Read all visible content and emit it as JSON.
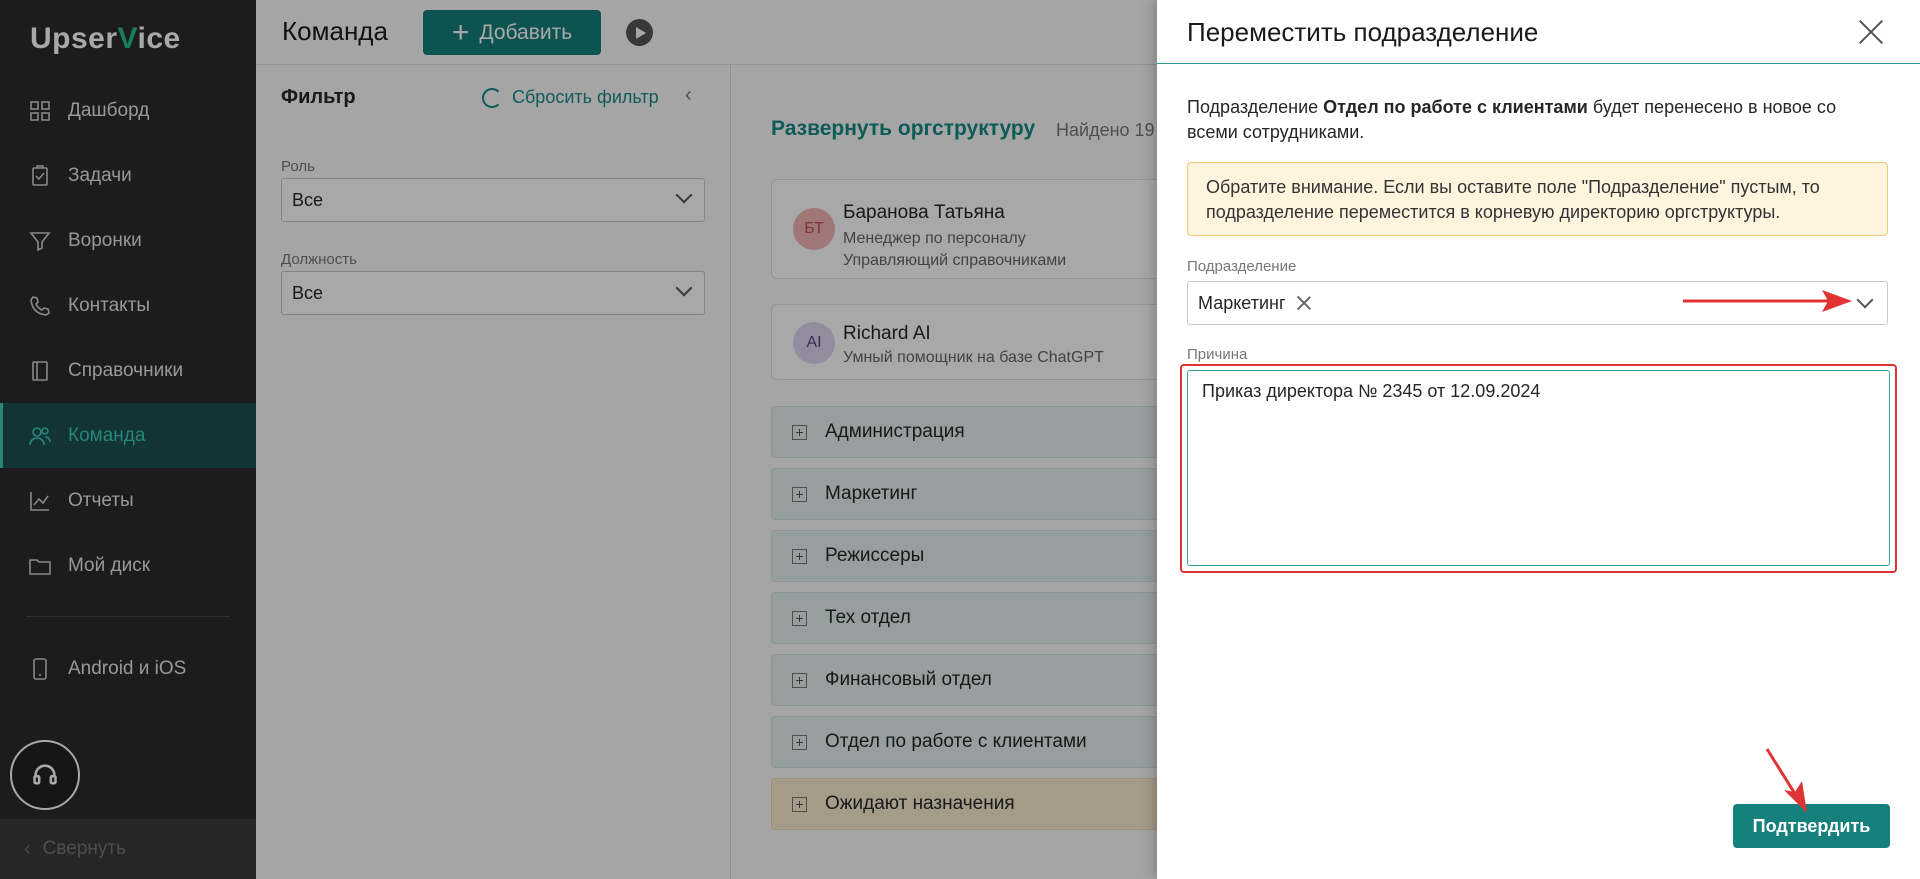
{
  "app": {
    "logo_prefix": "Upser",
    "logo_v": "V",
    "logo_suffix": "ice"
  },
  "sidebar": {
    "items": [
      {
        "label": "Дашборд",
        "icon": "dashboard-icon"
      },
      {
        "label": "Задачи",
        "icon": "tasks-icon"
      },
      {
        "label": "Воронки",
        "icon": "funnel-icon"
      },
      {
        "label": "Контакты",
        "icon": "contacts-icon"
      },
      {
        "label": "Справочники",
        "icon": "book-icon"
      },
      {
        "label": "Команда",
        "icon": "team-icon",
        "active": true
      },
      {
        "label": "Отчеты",
        "icon": "chart-icon"
      },
      {
        "label": "Мой диск",
        "icon": "folder-icon"
      }
    ],
    "mobile_label": "Android и iOS",
    "collapse_label": "Свернуть"
  },
  "header": {
    "title": "Команда",
    "add_label": "Добавить"
  },
  "filter": {
    "title": "Фильтр",
    "reset_label": "Сбросить фильтр",
    "role_label": "Роль",
    "role_value": "Все",
    "position_label": "Должность",
    "position_value": "Все"
  },
  "main": {
    "expand_label": "Развернуть оргструктуру",
    "found_label": "Найдено 19",
    "people": [
      {
        "initials": "БТ",
        "name": "Баранова Татьяна",
        "line1": "Менеджер по персоналу",
        "line2": "Управляющий справочниками"
      },
      {
        "initials": "AI",
        "name": "Richard AI",
        "line1": "Умный помощник на базе ChatGPT"
      }
    ],
    "departments": [
      "Администрация",
      "Маркетинг",
      "Режиссеры",
      "Тех отдел",
      "Финансовый отдел",
      "Отдел по работе с клиентами",
      "Ожидают назначения"
    ]
  },
  "drawer": {
    "title": "Переместить подразделение",
    "desc_prefix": "Подразделение ",
    "desc_dept": "Отдел по работе с клиентами",
    "desc_suffix": " будет перенесено в новое со всеми сотрудниками.",
    "warning": "Обратите внимание. Если вы оставите поле \"Подразделение\" пустым, то подразделение переместится в корневую директорию оргструктуры.",
    "dept_label": "Подразделение",
    "dept_value": "Маркетинг",
    "reason_label": "Причина",
    "reason_value": "Приказ директора № 2345 от 12.09.2024",
    "confirm_label": "Подтвердить"
  },
  "colors": {
    "accent": "#15807c",
    "sidebar_bg": "#2b2b2b",
    "annotation": "#e03434"
  }
}
